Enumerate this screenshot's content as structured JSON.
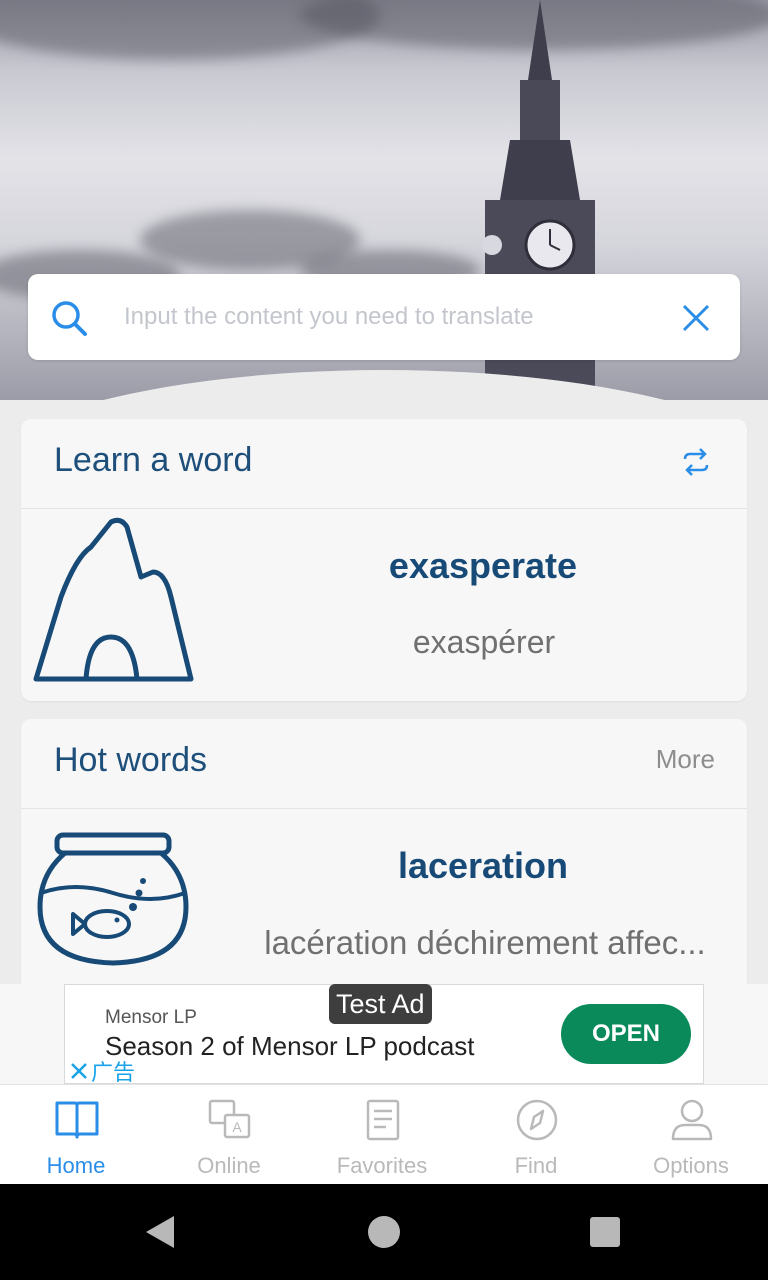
{
  "search": {
    "placeholder": "Input the content you need to translate"
  },
  "learn_card": {
    "title": "Learn a word",
    "word": "exasperate",
    "translation": "exaspérer"
  },
  "hot_card": {
    "title": "Hot words",
    "more_label": "More",
    "word": "laceration",
    "translation": "lacération déchirement affec..."
  },
  "ad": {
    "badge": "Test Ad",
    "advertiser": "Mensor LP",
    "headline": "Season 2 of Mensor LP podcast",
    "cta": "OPEN",
    "close_label": "广告"
  },
  "nav": {
    "items": [
      {
        "label": "Home",
        "icon": "book-icon",
        "active": true
      },
      {
        "label": "Online",
        "icon": "translate-icon",
        "active": false
      },
      {
        "label": "Favorites",
        "icon": "notebook-icon",
        "active": false
      },
      {
        "label": "Find",
        "icon": "compass-icon",
        "active": false
      },
      {
        "label": "Options",
        "icon": "person-icon",
        "active": false
      }
    ]
  },
  "colors": {
    "accent": "#2a8ee8",
    "title_blue": "#1d4f7a",
    "cta_green": "#0a8a5a"
  }
}
